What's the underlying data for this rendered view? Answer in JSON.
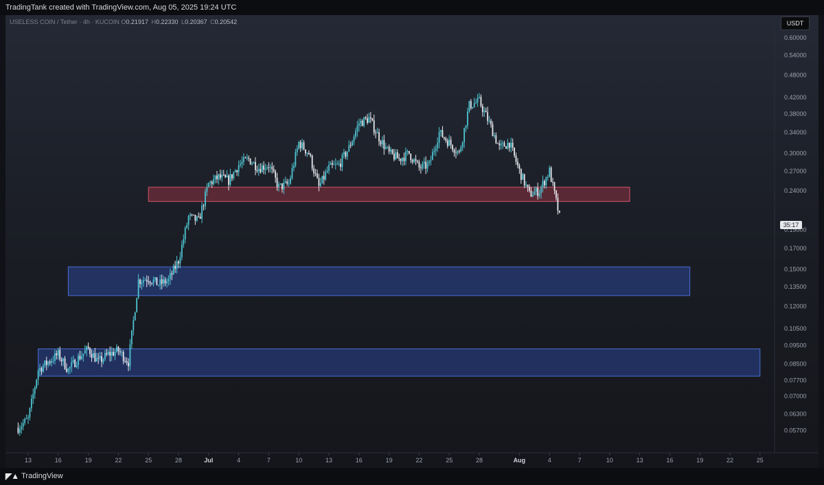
{
  "header": {
    "attribution": "TradingTank created with TradingView.com, Aug 05, 2025 19:24 UTC"
  },
  "symbol": {
    "name": "USELESS COIN / Tether · 4h · KUCOIN",
    "open_label": "O",
    "open": "0.21917",
    "high_label": "H",
    "high": "0.22330",
    "low_label": "L",
    "low": "0.20367",
    "close_label": "C",
    "close": "0.20542"
  },
  "price_axis": {
    "currency": "USDT",
    "countdown": "35:17"
  },
  "footer": {
    "brand": "TradingView"
  },
  "colors": {
    "up_candle": "#4ec5d2",
    "down_candle": "#e7e9ee",
    "resistance_zone": "#c0394f",
    "support_zone": "#2f51b8",
    "axis_text": "#9da1ad"
  },
  "chart_data": {
    "type": "candlestick",
    "scale": "log",
    "ylim": [
      0.052,
      0.6
    ],
    "y_ticks": [
      "0.60000",
      "0.54000",
      "0.48000",
      "0.42000",
      "0.38000",
      "0.34000",
      "0.30000",
      "0.27000",
      "0.24000",
      "0.19000",
      "0.17000",
      "0.15000",
      "0.13500",
      "0.12000",
      "0.10500",
      "0.09500",
      "0.08500",
      "0.07700",
      "0.07000",
      "0.06300",
      "0.05700"
    ],
    "x_ticks": [
      "13",
      "16",
      "19",
      "22",
      "25",
      "28",
      "Jul",
      "4",
      "7",
      "10",
      "13",
      "16",
      "19",
      "22",
      "25",
      "28",
      "Aug",
      "4",
      "7",
      "10",
      "13",
      "16",
      "19",
      "22",
      "25"
    ],
    "x_tick_dates": [
      "06-13",
      "06-16",
      "06-19",
      "06-22",
      "06-25",
      "06-28",
      "07-01",
      "07-04",
      "07-07",
      "07-10",
      "07-13",
      "07-16",
      "07-19",
      "07-22",
      "07-25",
      "07-28",
      "08-01",
      "08-04",
      "08-07",
      "08-10",
      "08-13",
      "08-16",
      "08-19",
      "08-22",
      "08-25"
    ],
    "price_path": [
      [
        "06-12",
        0.058
      ],
      [
        "06-13",
        0.061
      ],
      [
        "06-14",
        0.082
      ],
      [
        "06-15",
        0.086
      ],
      [
        "06-16",
        0.09
      ],
      [
        "06-17",
        0.082
      ],
      [
        "06-18",
        0.088
      ],
      [
        "06-19",
        0.093
      ],
      [
        "06-20",
        0.086
      ],
      [
        "06-21",
        0.09
      ],
      [
        "06-22",
        0.092
      ],
      [
        "06-23",
        0.086
      ],
      [
        "06-24",
        0.14
      ],
      [
        "06-25",
        0.142
      ],
      [
        "06-26",
        0.137
      ],
      [
        "06-27",
        0.14
      ],
      [
        "06-28",
        0.158
      ],
      [
        "06-29",
        0.205
      ],
      [
        "06-30",
        0.2
      ],
      [
        "07-01",
        0.25
      ],
      [
        "07-02",
        0.26
      ],
      [
        "07-03",
        0.255
      ],
      [
        "07-04",
        0.28
      ],
      [
        "07-05",
        0.29
      ],
      [
        "07-06",
        0.275
      ],
      [
        "07-07",
        0.28
      ],
      [
        "07-08",
        0.245
      ],
      [
        "07-09",
        0.25
      ],
      [
        "07-10",
        0.32
      ],
      [
        "07-11",
        0.3
      ],
      [
        "07-12",
        0.245
      ],
      [
        "07-13",
        0.275
      ],
      [
        "07-14",
        0.28
      ],
      [
        "07-15",
        0.31
      ],
      [
        "07-16",
        0.36
      ],
      [
        "07-17",
        0.37
      ],
      [
        "07-18",
        0.33
      ],
      [
        "07-19",
        0.3
      ],
      [
        "07-20",
        0.29
      ],
      [
        "07-21",
        0.3
      ],
      [
        "07-22",
        0.275
      ],
      [
        "07-23",
        0.28
      ],
      [
        "07-24",
        0.34
      ],
      [
        "07-25",
        0.32
      ],
      [
        "07-26",
        0.3
      ],
      [
        "07-27",
        0.4
      ],
      [
        "07-28",
        0.41
      ],
      [
        "07-29",
        0.36
      ],
      [
        "07-30",
        0.31
      ],
      [
        "07-31",
        0.32
      ],
      [
        "08-01",
        0.27
      ],
      [
        "08-02",
        0.235
      ],
      [
        "08-03",
        0.24
      ],
      [
        "08-04",
        0.27
      ],
      [
        "08-05",
        0.205
      ]
    ],
    "zones": [
      {
        "type": "resistance",
        "from": "06-25",
        "to": "08-12",
        "low": 0.225,
        "high": 0.245
      },
      {
        "type": "support",
        "from": "06-17",
        "to": "08-18",
        "low": 0.128,
        "high": 0.152
      },
      {
        "type": "support",
        "from": "06-14",
        "to": "08-25",
        "low": 0.079,
        "high": 0.093
      }
    ]
  }
}
